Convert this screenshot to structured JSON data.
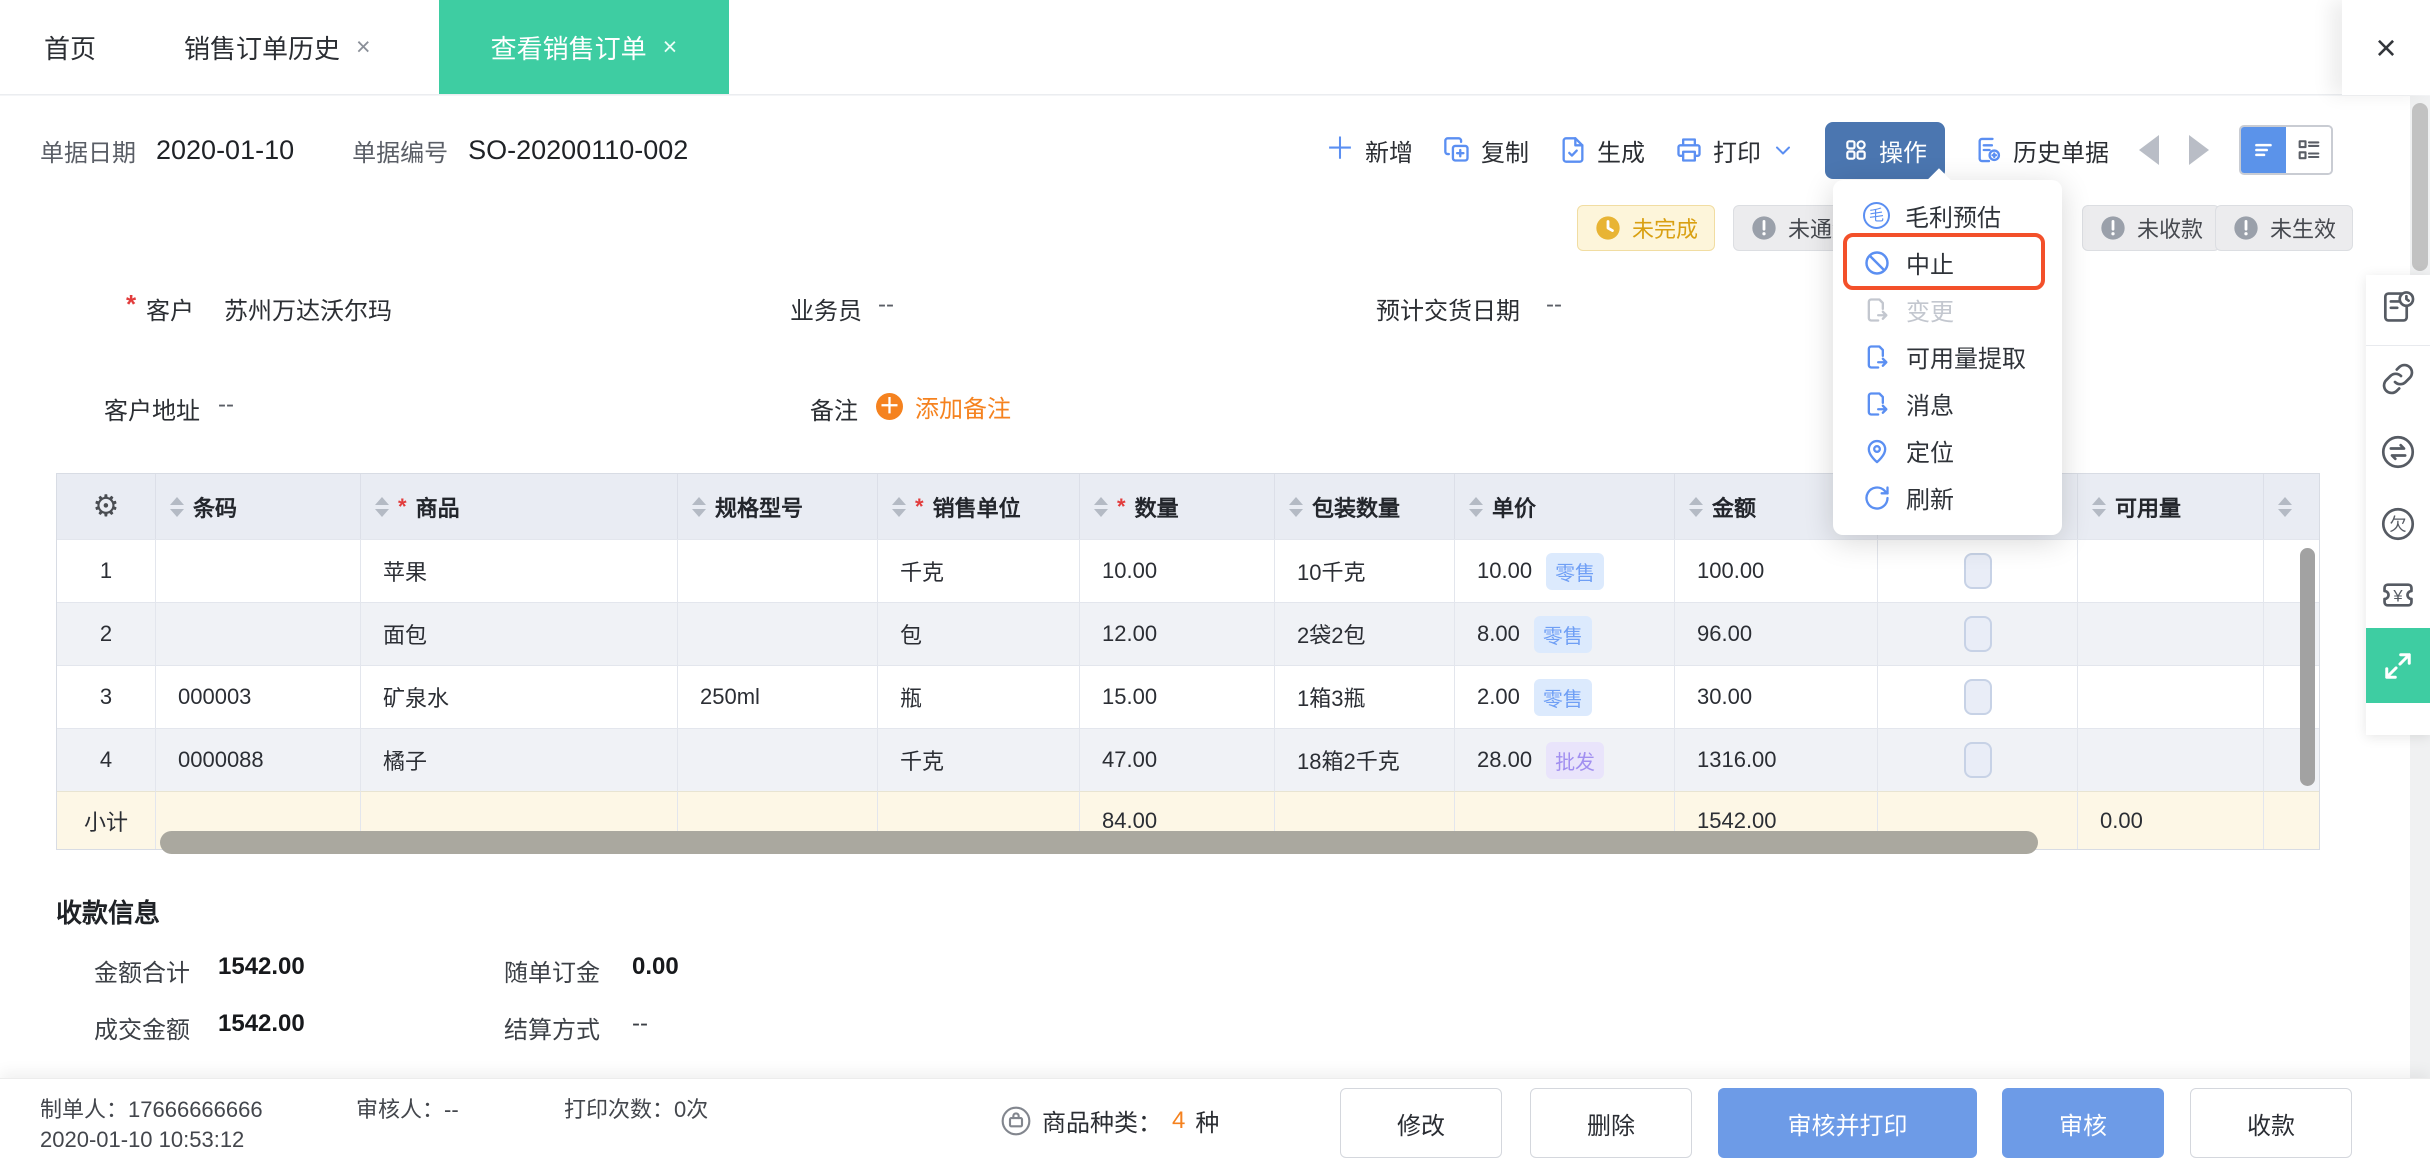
{
  "tab_bar": {
    "tabs": [
      {
        "label": "首页"
      },
      {
        "label": "销售订单历史",
        "close": "×"
      },
      {
        "label": "查看销售订单",
        "close": "×",
        "active": true
      }
    ],
    "window_close": "×"
  },
  "toolbar": {
    "doc_date_label": "单据日期",
    "doc_date": "2020-01-10",
    "doc_no_label": "单据编号",
    "doc_no": "SO-20200110-002",
    "add": "新增",
    "copy": "复制",
    "generate": "生成",
    "print": "打印",
    "actions": "操作",
    "history": "历史单据"
  },
  "status_badges": [
    {
      "label": "未完成",
      "type": "warning"
    },
    {
      "label": "未通知",
      "type": "default"
    },
    {
      "label": "未收款",
      "type": "default"
    },
    {
      "label": "未生效",
      "type": "default"
    }
  ],
  "action_menu": {
    "items": [
      {
        "label": "毛利预估"
      },
      {
        "label": "中止",
        "highlighted": true
      },
      {
        "label": "变更",
        "disabled": true
      },
      {
        "label": "可用量提取"
      },
      {
        "label": "消息"
      },
      {
        "label": "定位"
      },
      {
        "label": "刷新"
      }
    ]
  },
  "form": {
    "required_marker": "*",
    "customer_label": "客户",
    "customer_value": "苏州万达沃尔玛",
    "salesman_label": "业务员",
    "salesman_value": "--",
    "delivery_date_label": "预计交货日期",
    "delivery_date_value": "--",
    "address_label": "客户地址",
    "address_value": "--",
    "remark_label": "备注",
    "add_remark": "添加备注"
  },
  "items_table": {
    "headers": {
      "barcode": "条码",
      "product": "商品",
      "spec": "规格型号",
      "unit": "销售单位",
      "qty": "数量",
      "pack_qty": "包装数量",
      "price": "单价",
      "amount": "金额",
      "available": "可用量"
    },
    "rows": [
      {
        "no": "1",
        "barcode": "",
        "product": "苹果",
        "spec": "",
        "unit": "千克",
        "qty": "10.00",
        "pack_qty": "10千克",
        "price": "10.00",
        "price_tag": "零售",
        "price_tag_type": "retail",
        "amount": "100.00",
        "available": ""
      },
      {
        "no": "2",
        "barcode": "",
        "product": "面包",
        "spec": "",
        "unit": "包",
        "qty": "12.00",
        "pack_qty": "2袋2包",
        "price": "8.00",
        "price_tag": "零售",
        "price_tag_type": "retail",
        "amount": "96.00",
        "available": ""
      },
      {
        "no": "3",
        "barcode": "000003",
        "product": "矿泉水",
        "spec": "250ml",
        "unit": "瓶",
        "qty": "15.00",
        "pack_qty": "1箱3瓶",
        "price": "2.00",
        "price_tag": "零售",
        "price_tag_type": "retail",
        "amount": "30.00",
        "available": ""
      },
      {
        "no": "4",
        "barcode": "0000088",
        "product": "橘子",
        "spec": "",
        "unit": "千克",
        "qty": "47.00",
        "pack_qty": "18箱2千克",
        "price": "28.00",
        "price_tag": "批发",
        "price_tag_type": "wholesale",
        "amount": "1316.00",
        "available": ""
      }
    ],
    "subtotal": {
      "label": "小计",
      "qty": "84.00",
      "amount": "1542.00",
      "available": "0.00"
    }
  },
  "payment": {
    "title": "收款信息",
    "total_label": "金额合计",
    "total_value": "1542.00",
    "deposit_label": "随单订金",
    "deposit_value": "0.00",
    "deal_label": "成交金额",
    "deal_value": "1542.00",
    "settlement_label": "结算方式",
    "settlement_value": "--"
  },
  "footer": {
    "creator_label": "制单人：",
    "creator_value": "17666666666",
    "created_time": "2020-01-10 10:53:12",
    "auditor_label": "审核人：",
    "auditor_value": "--",
    "print_count_label": "打印次数：",
    "print_count_value": "0次",
    "category_label": "商品种类：",
    "category_count": "4",
    "category_unit": "种",
    "buttons": {
      "modify": "修改",
      "delete": "删除",
      "audit_print": "审核并打印",
      "audit": "审核",
      "receive": "收款"
    }
  },
  "colors": {
    "accent_teal": "#3ecda2",
    "primary_icon_blue": "#5b8ff2",
    "actions_button_blue": "#4b76b0",
    "footer_button_blue": "#6d9be7",
    "view_toggle_blue": "#5b93ea",
    "highlight_red": "#f3502a",
    "orange": "#f5821f",
    "warning_badge_text": "#d9a012",
    "retail_tag_text": "#6f9ff5",
    "wholesale_tag_text": "#a18ff0",
    "subtotal_row_bg": "#fdf7e6",
    "table_header_bg": "#e9ecf3"
  }
}
